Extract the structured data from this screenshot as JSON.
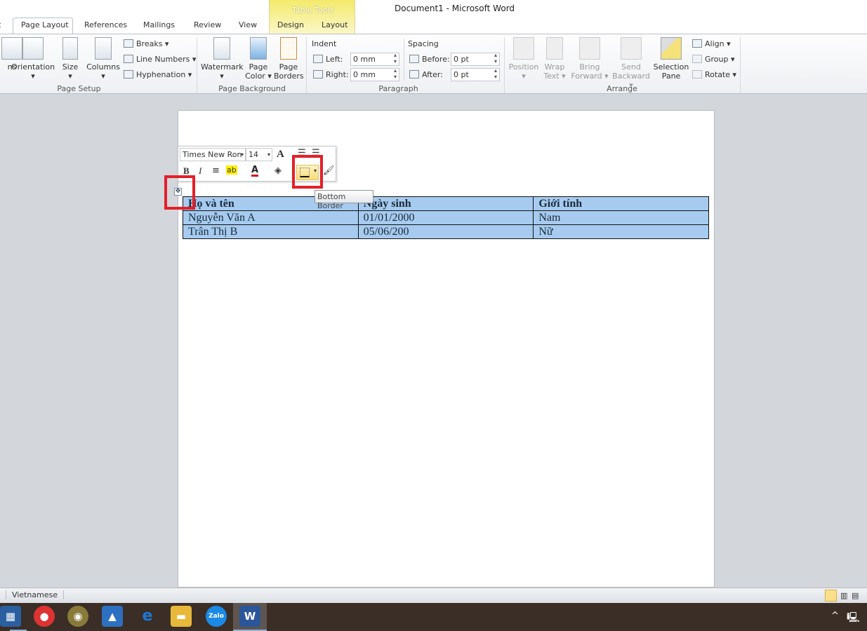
{
  "window": {
    "title": "Document1  -  Microsoft Word",
    "context_tab_group": "Table Tools"
  },
  "tabs": [
    {
      "label": "t"
    },
    {
      "label": "Page Layout",
      "active": true
    },
    {
      "label": "References"
    },
    {
      "label": "Mailings"
    },
    {
      "label": "Review"
    },
    {
      "label": "View"
    },
    {
      "label": "Design"
    },
    {
      "label": "Layout"
    }
  ],
  "ribbon": {
    "page_setup": {
      "label": "Page Setup",
      "margins": "ns",
      "orientation": "Orientation",
      "size": "Size",
      "columns": "Columns",
      "breaks": "Breaks",
      "line_numbers": "Line Numbers",
      "hyphenation": "Hyphenation"
    },
    "page_background": {
      "label": "Page Background",
      "watermark": "Watermark",
      "page_color_1": "Page",
      "page_color_2": "Color",
      "page_borders_1": "Page",
      "page_borders_2": "Borders"
    },
    "paragraph": {
      "label": "Paragraph",
      "indent": "Indent",
      "left_label": "Left:",
      "left_value": "0 mm",
      "right_label": "Right:",
      "right_value": "0 mm",
      "spacing": "Spacing",
      "before_label": "Before:",
      "before_value": "0 pt",
      "after_label": "After:",
      "after_value": "0 pt"
    },
    "arrange": {
      "label": "Arrange",
      "position": "Position",
      "wrap_1": "Wrap",
      "wrap_2": "Text",
      "bring_1": "Bring",
      "bring_2": "Forward",
      "send_1": "Send",
      "send_2": "Backward",
      "selection_1": "Selection",
      "selection_2": "Pane",
      "align": "Align",
      "group": "Group",
      "rotate": "Rotate"
    }
  },
  "mini_toolbar": {
    "font": "Times New Ron",
    "size": "14",
    "tooltip": "Bottom Border"
  },
  "table": {
    "rows": [
      [
        "Họ và tên",
        "Ngày sinh",
        "Giới tính"
      ],
      [
        "Nguyễn Văn A",
        "01/01/2000",
        "Nam"
      ],
      [
        "Trân Thị B",
        "05/06/200",
        "Nữ"
      ]
    ]
  },
  "status": {
    "language": "Vietnamese"
  },
  "colors": {
    "selection": "#a6cbef",
    "highlight_box": "#e51f28",
    "taskbar": "#3b2e27"
  }
}
